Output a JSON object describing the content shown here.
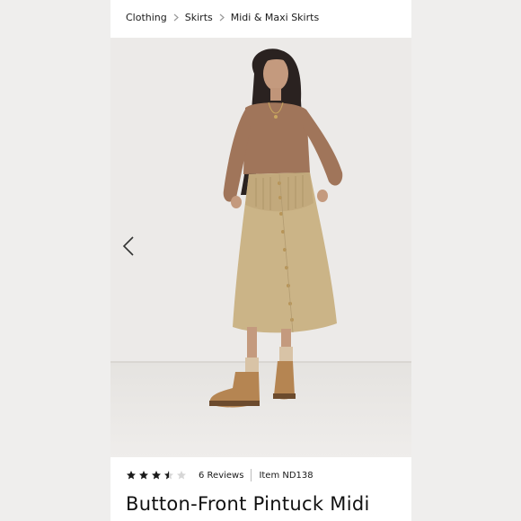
{
  "breadcrumb": {
    "items": [
      "Clothing",
      "Skirts",
      "Midi & Maxi Skirts"
    ]
  },
  "gallery": {
    "prev_icon": "chevron-left-icon"
  },
  "rating": {
    "stars": 3.5,
    "max_stars": 5,
    "reviews_label": "6 Reviews",
    "item_label": "Item ND138"
  },
  "product": {
    "title": "Button-Front Pintuck Midi"
  },
  "colors": {
    "background": "#efeeed",
    "star_filled": "#1a1a1a",
    "star_empty": "#d6d6d6",
    "text": "#1a1a1a"
  }
}
